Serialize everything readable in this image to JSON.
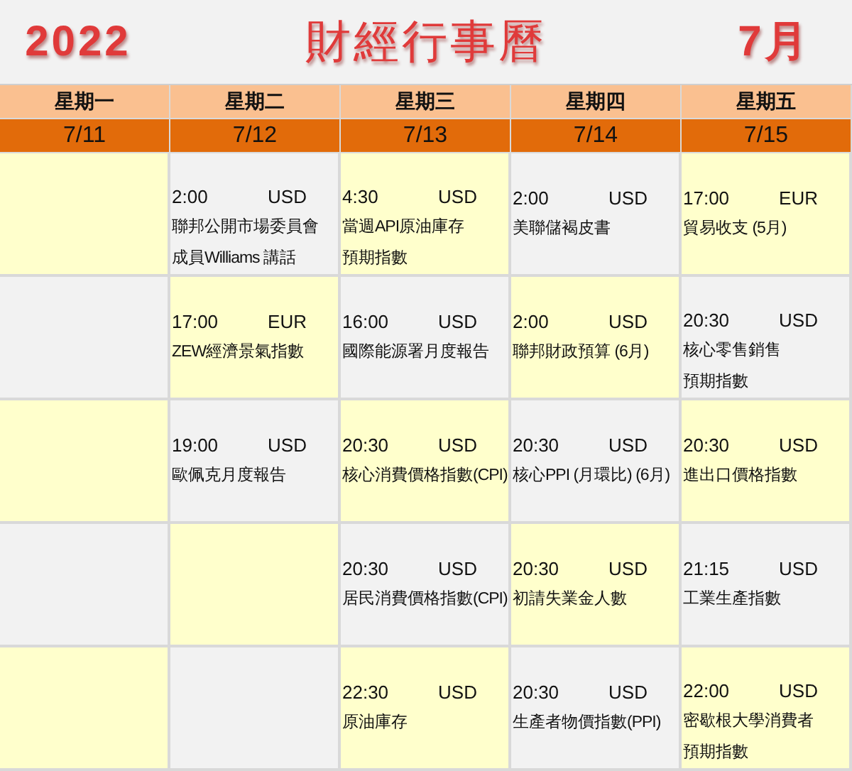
{
  "header": {
    "year": "2022",
    "title": "財經行事曆",
    "month": "7月"
  },
  "days": [
    {
      "weekday": "星期一",
      "date": "7/11"
    },
    {
      "weekday": "星期二",
      "date": "7/12"
    },
    {
      "weekday": "星期三",
      "date": "7/13"
    },
    {
      "weekday": "星期四",
      "date": "7/14"
    },
    {
      "weekday": "星期五",
      "date": "7/15"
    }
  ],
  "rows": [
    [
      null,
      {
        "time": "2:00",
        "currency": "USD",
        "lines": [
          "聯邦公開市場委員會",
          "成員Williams 講話"
        ]
      },
      {
        "time": "4:30",
        "currency": "USD",
        "lines": [
          "當週API原油庫存",
          "預期指數"
        ]
      },
      {
        "time": "2:00",
        "currency": "USD",
        "lines": [
          "美聯儲褐皮書"
        ]
      },
      {
        "time": "17:00",
        "currency": "EUR",
        "lines": [
          "貿易收支 (5月)"
        ]
      }
    ],
    [
      null,
      {
        "time": "17:00",
        "currency": "EUR",
        "lines": [
          "ZEW經濟景氣指數"
        ]
      },
      {
        "time": "16:00",
        "currency": "USD",
        "lines": [
          "國際能源署月度報告"
        ]
      },
      {
        "time": "2:00",
        "currency": "USD",
        "lines": [
          "聯邦財政預算 (6月)"
        ]
      },
      {
        "time": "20:30",
        "currency": "USD",
        "lines": [
          "核心零售銷售",
          "預期指數"
        ]
      }
    ],
    [
      null,
      {
        "time": "19:00",
        "currency": "USD",
        "lines": [
          "歐佩克月度報告"
        ]
      },
      {
        "time": "20:30",
        "currency": "USD",
        "lines": [
          "核心消費價格指數(CPI)"
        ]
      },
      {
        "time": "20:30",
        "currency": "USD",
        "lines": [
          "核心PPI (月環比) (6月)"
        ]
      },
      {
        "time": "20:30",
        "currency": "USD",
        "lines": [
          "進出口價格指數"
        ]
      }
    ],
    [
      null,
      null,
      {
        "time": "20:30",
        "currency": "USD",
        "lines": [
          "居民消費價格指數(CPI)"
        ]
      },
      {
        "time": "20:30",
        "currency": "USD",
        "lines": [
          "初請失業金人數"
        ]
      },
      {
        "time": "21:15",
        "currency": "USD",
        "lines": [
          "工業生產指數"
        ]
      }
    ],
    [
      null,
      null,
      {
        "time": "22:30",
        "currency": "USD",
        "lines": [
          "原油庫存"
        ]
      },
      {
        "time": "20:30",
        "currency": "USD",
        "lines": [
          "生產者物價指數(PPI)"
        ]
      },
      {
        "time": "22:00",
        "currency": "USD",
        "lines": [
          "密歇根大學消費者",
          "預期指數"
        ]
      }
    ]
  ]
}
